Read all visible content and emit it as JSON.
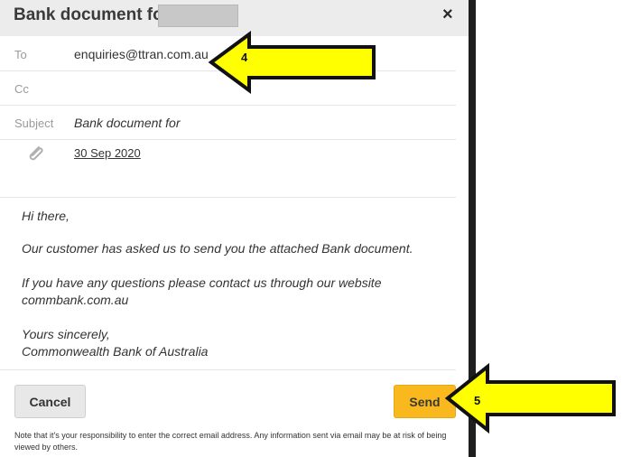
{
  "dialog": {
    "title": "Bank document for",
    "close_glyph": "×"
  },
  "fields": {
    "to_label": "To",
    "to_value": "enquiries@ttran.com.au",
    "cc_label": "Cc",
    "cc_value": "",
    "subject_label": "Subject",
    "subject_value": "Bank document for"
  },
  "attachment": {
    "icon": "paperclip-icon",
    "label": "30 Sep 2020"
  },
  "message": {
    "greeting": "Hi there,",
    "line1": "Our customer has asked us to send you the attached Bank document.",
    "line2a": "If you have any questions please contact us through our website",
    "line2b": "commbank.com.au",
    "signoff": "Yours sincerely,",
    "sender": "Commonwealth Bank of Australia"
  },
  "buttons": {
    "cancel": "Cancel",
    "send": "Send"
  },
  "disclaimer": "Note that it's your responsibility to enter the correct email address. Any information sent via email may be at risk of being viewed by others.",
  "annotations": {
    "arrow_to_label": "4",
    "arrow_send_label": "5",
    "arrow_color": "#ffff00"
  }
}
